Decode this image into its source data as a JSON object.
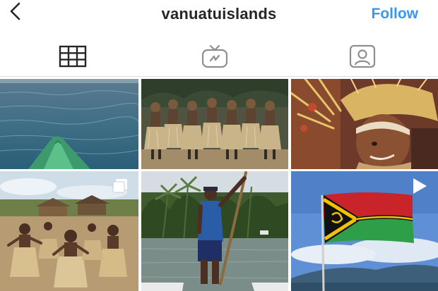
{
  "header": {
    "username": "vanuatuislands",
    "follow_label": "Follow",
    "accent_color": "#3897f0",
    "back_icon": "chevron-left-icon"
  },
  "tabs": [
    {
      "icon": "grid-icon",
      "selected": true
    },
    {
      "icon": "igtv-icon",
      "selected": false
    },
    {
      "icon": "tagged-person-icon",
      "selected": false
    }
  ],
  "posts": [
    {
      "subject": "kayak bow on turquoise ocean",
      "badge": null
    },
    {
      "subject": "traditional dance group in grass skirts",
      "badge": null
    },
    {
      "subject": "girl with feather headdress",
      "badge": null
    },
    {
      "subject": "village dancers in grass skirts",
      "badge": "carousel-icon"
    },
    {
      "subject": "man with paddle on canoe",
      "badge": null
    },
    {
      "subject": "Vanuatu flag over sea",
      "badge": "video-play-icon"
    }
  ]
}
